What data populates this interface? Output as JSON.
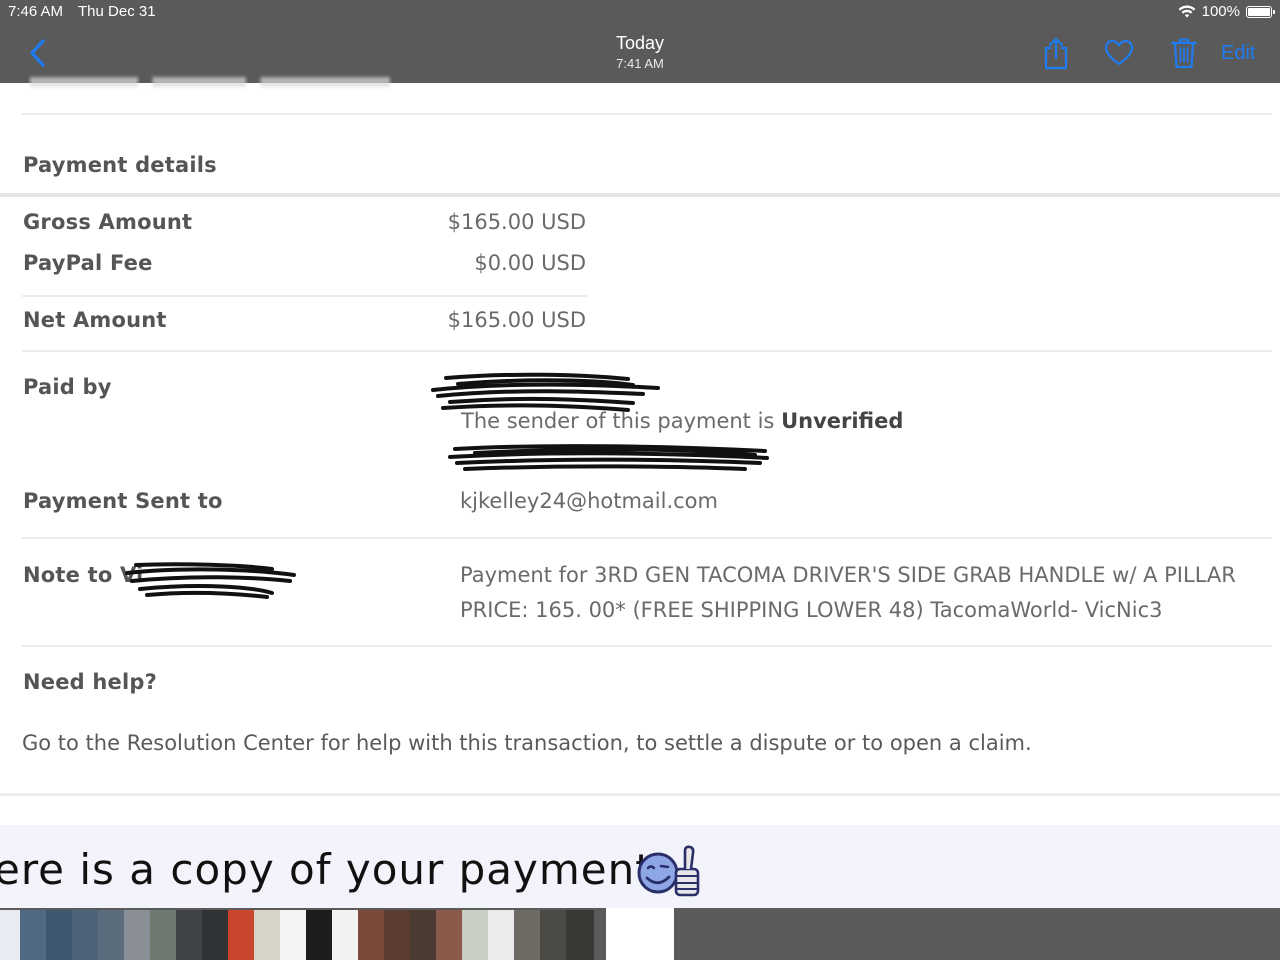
{
  "status_bar": {
    "time": "7:46 AM",
    "date": "Thu Dec 31",
    "battery": "100%"
  },
  "nav": {
    "title": "Today",
    "subtitle": "7:41 AM",
    "edit_label": "Edit",
    "icons": [
      "chevron-left-icon",
      "share-icon",
      "heart-icon",
      "trash-icon"
    ],
    "accent_color": "#1e7cf2"
  },
  "payment": {
    "section_title": "Payment details",
    "gross_label": "Gross Amount",
    "gross_value": "$165.00 USD",
    "fee_label": "PayPal Fee",
    "fee_value": "$0.00 USD",
    "net_label": "Net Amount",
    "net_value": "$165.00 USD",
    "paid_by_label": "Paid by",
    "sender_note": "The sender of this payment is",
    "sender_status": "Unverified",
    "sent_to_label": "Payment Sent to",
    "sent_to_value": "kjkelley24@hotmail.com",
    "note_label": "Note to Vi",
    "note_line1": "Payment for 3RD GEN TACOMA DRIVER'S SIDE GRAB HANDLE w/ A PILLAR",
    "note_line2": "PRICE: 165. 00* (FREE SHIPPING LOWER 48) TacomaWorld- VicNic3",
    "help_title": "Need help?",
    "help_text": "Go to the Resolution Center for help with this transaction, to settle a dispute or to open a claim."
  },
  "banner": {
    "text": "ere is a copy of your payment"
  }
}
